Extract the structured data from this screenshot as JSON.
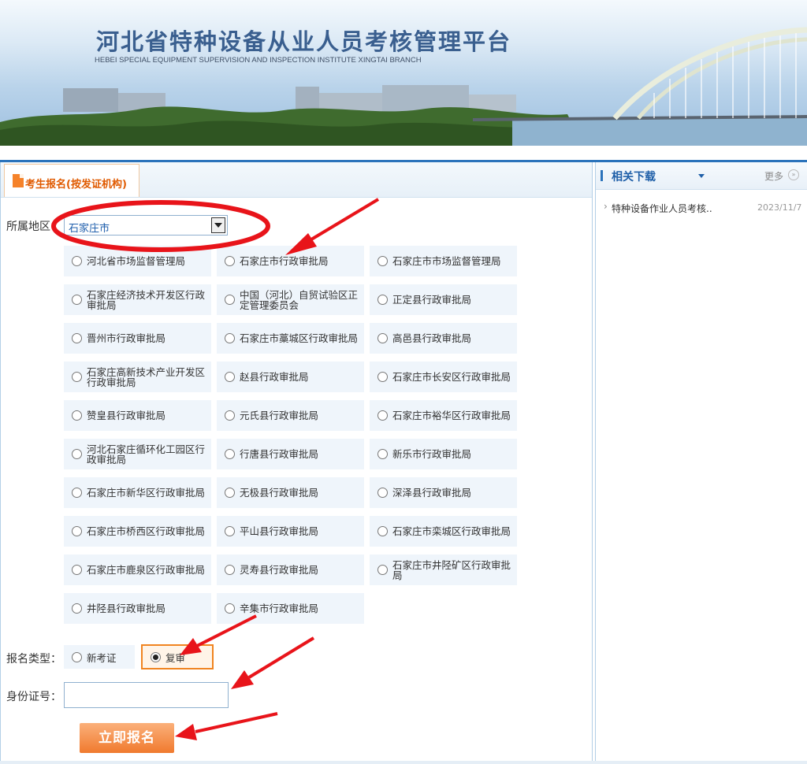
{
  "banner": {
    "title": "河北省特种设备从业人员考核管理平台",
    "subtitle": "HEBEI SPECIAL EQUIPMENT SUPERVISION AND INSPECTION INSTITUTE  XINGTAI BRANCH"
  },
  "tab": {
    "label": "考生报名(按发证机构)"
  },
  "form": {
    "region_label": "所属地区",
    "region_value": "石家庄市",
    "orgs": [
      "河北省市场监督管理局",
      "石家庄市行政审批局",
      "石家庄市市场监督管理局",
      "石家庄经济技术开发区行政审批局",
      "中国（河北）自贸试验区正定管理委员会",
      "正定县行政审批局",
      "晋州市行政审批局",
      "石家庄市藁城区行政审批局",
      "高邑县行政审批局",
      "石家庄高新技术产业开发区行政审批局",
      "赵县行政审批局",
      "石家庄市长安区行政审批局",
      "赞皇县行政审批局",
      "元氏县行政审批局",
      "石家庄市裕华区行政审批局",
      "河北石家庄循环化工园区行政审批局",
      "行唐县行政审批局",
      "新乐市行政审批局",
      "石家庄市新华区行政审批局",
      "无极县行政审批局",
      "深泽县行政审批局",
      "石家庄市桥西区行政审批局",
      "平山县行政审批局",
      "石家庄市栾城区行政审批局",
      "石家庄市鹿泉区行政审批局",
      "灵寿县行政审批局",
      "石家庄市井陉矿区行政审批局",
      "井陉县行政审批局",
      "辛集市行政审批局"
    ],
    "type_label": "报名类型：",
    "type_options": [
      "新考证",
      "复审"
    ],
    "type_selected": "复审",
    "id_label": "身份证号：",
    "id_value": "",
    "submit_label": "立即报名"
  },
  "sidebar": {
    "title": "相关下载",
    "more_label": "更多",
    "items": [
      {
        "label": "特种设备作业人员考核..",
        "date": "2023/11/7"
      }
    ]
  },
  "annotation_color": "#e8141a"
}
